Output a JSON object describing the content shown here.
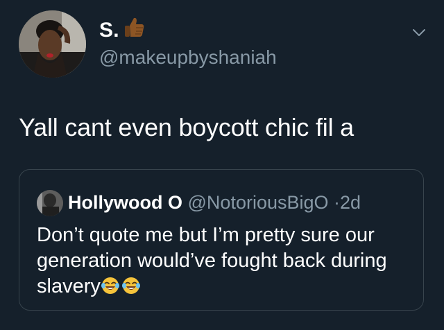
{
  "tweet": {
    "author": {
      "display_name": "S.",
      "handle": "@makeupbyshaniah"
    },
    "text": "Yall cant even boycott chic fil a",
    "quoted": {
      "author_name": "Hollywood O",
      "author_handle": "@NotoriousBigO",
      "separator": "·",
      "time": "2d",
      "text": "Don’t quote me but I’m pretty sure our generation would’ve fought back during slavery"
    }
  },
  "icons": {
    "name_emoji": "thumbs-up-icon",
    "more": "chevron-down-icon",
    "text_emoji": "tears-of-joy-emoji-icon"
  },
  "colors": {
    "background": "#15202b",
    "secondary_text": "#8899a6",
    "border": "#38444d"
  }
}
